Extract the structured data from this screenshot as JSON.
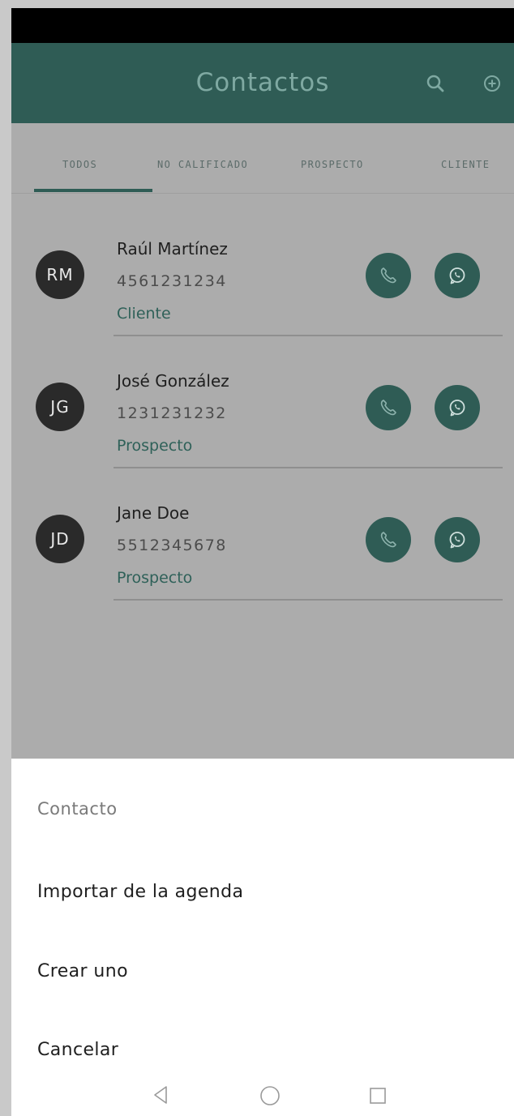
{
  "app_bar": {
    "title": "Contactos",
    "icons": [
      "search-icon",
      "add-circle-icon"
    ],
    "color": "#2f5c55"
  },
  "tabs": [
    {
      "label": "TODOS",
      "selected": true
    },
    {
      "label": "NO CALIFICADO",
      "selected": false
    },
    {
      "label": "PROSPECTO",
      "selected": false
    },
    {
      "label": "CLIENTE",
      "selected": false
    }
  ],
  "contacts": [
    {
      "initials": "RM",
      "name": "Raúl Martínez",
      "phone": "4561231234",
      "status": "Cliente"
    },
    {
      "initials": "JG",
      "name": "José González",
      "phone": "1231231232",
      "status": "Prospecto"
    },
    {
      "initials": "JD",
      "name": "Jane Doe",
      "phone": "5512345678",
      "status": "Prospecto"
    }
  ],
  "sheet": {
    "title": "Contacto",
    "items": [
      "Importar de la agenda",
      "Crear uno",
      "Cancelar"
    ]
  },
  "nav_bar": {
    "icons": [
      "back-icon",
      "home-icon",
      "recents-icon"
    ]
  }
}
